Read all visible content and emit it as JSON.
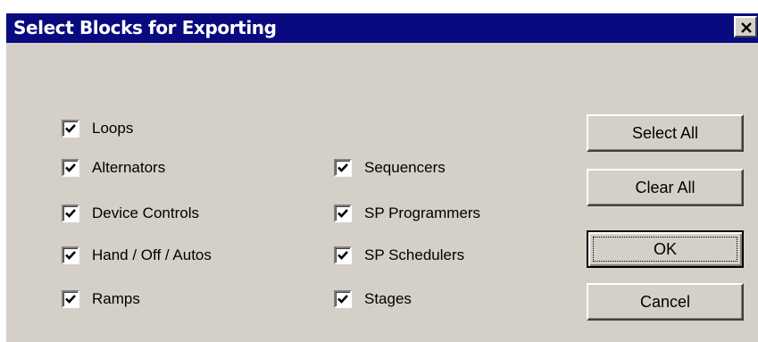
{
  "window": {
    "title": "Select Blocks for Exporting"
  },
  "checkboxes_left": [
    {
      "label": "Loops",
      "checked": true
    },
    {
      "label": "Alternators",
      "checked": true
    },
    {
      "label": "Device Controls",
      "checked": true
    },
    {
      "label": "Hand / Off / Autos",
      "checked": true
    },
    {
      "label": "Ramps",
      "checked": true
    }
  ],
  "checkboxes_right": [
    {
      "label": "Sequencers",
      "checked": true
    },
    {
      "label": "SP Programmers",
      "checked": true
    },
    {
      "label": "SP Schedulers",
      "checked": true
    },
    {
      "label": "Stages",
      "checked": true
    }
  ],
  "buttons": {
    "select_all": "Select All",
    "clear_all": "Clear All",
    "ok": "OK",
    "cancel": "Cancel"
  },
  "icons": {
    "close": "close-icon",
    "check": "checkmark-icon"
  }
}
